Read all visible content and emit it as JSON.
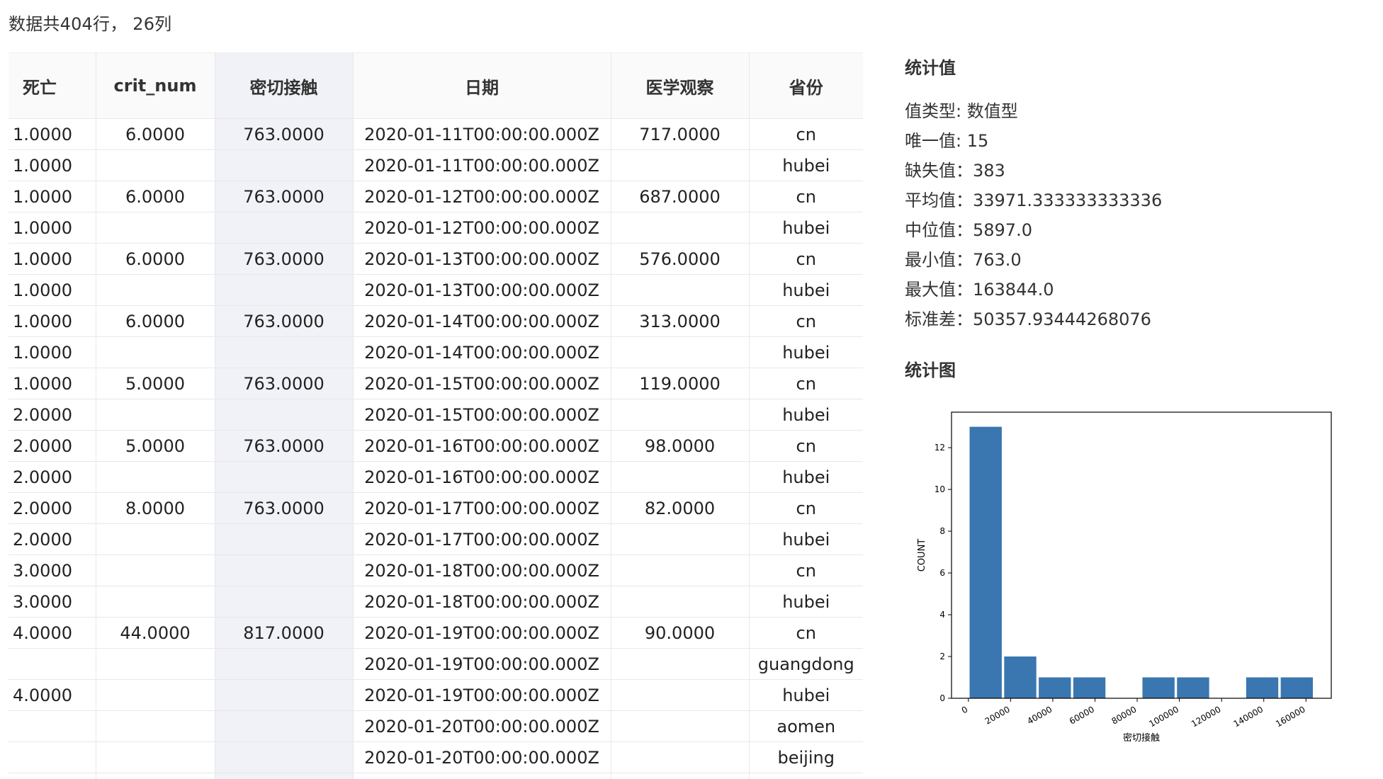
{
  "summary": "数据共404行， 26列",
  "table": {
    "columns": [
      "死亡",
      "crit_num",
      "密切接触",
      "日期",
      "医学观察",
      "省份"
    ],
    "rows": [
      [
        "1.0000",
        "6.0000",
        "763.0000",
        "2020-01-11T00:00:00.000Z",
        "717.0000",
        "cn"
      ],
      [
        "1.0000",
        "",
        "",
        "2020-01-11T00:00:00.000Z",
        "",
        "hubei"
      ],
      [
        "1.0000",
        "6.0000",
        "763.0000",
        "2020-01-12T00:00:00.000Z",
        "687.0000",
        "cn"
      ],
      [
        "1.0000",
        "",
        "",
        "2020-01-12T00:00:00.000Z",
        "",
        "hubei"
      ],
      [
        "1.0000",
        "6.0000",
        "763.0000",
        "2020-01-13T00:00:00.000Z",
        "576.0000",
        "cn"
      ],
      [
        "1.0000",
        "",
        "",
        "2020-01-13T00:00:00.000Z",
        "",
        "hubei"
      ],
      [
        "1.0000",
        "6.0000",
        "763.0000",
        "2020-01-14T00:00:00.000Z",
        "313.0000",
        "cn"
      ],
      [
        "1.0000",
        "",
        "",
        "2020-01-14T00:00:00.000Z",
        "",
        "hubei"
      ],
      [
        "1.0000",
        "5.0000",
        "763.0000",
        "2020-01-15T00:00:00.000Z",
        "119.0000",
        "cn"
      ],
      [
        "2.0000",
        "",
        "",
        "2020-01-15T00:00:00.000Z",
        "",
        "hubei"
      ],
      [
        "2.0000",
        "5.0000",
        "763.0000",
        "2020-01-16T00:00:00.000Z",
        "98.0000",
        "cn"
      ],
      [
        "2.0000",
        "",
        "",
        "2020-01-16T00:00:00.000Z",
        "",
        "hubei"
      ],
      [
        "2.0000",
        "8.0000",
        "763.0000",
        "2020-01-17T00:00:00.000Z",
        "82.0000",
        "cn"
      ],
      [
        "2.0000",
        "",
        "",
        "2020-01-17T00:00:00.000Z",
        "",
        "hubei"
      ],
      [
        "3.0000",
        "",
        "",
        "2020-01-18T00:00:00.000Z",
        "",
        "cn"
      ],
      [
        "3.0000",
        "",
        "",
        "2020-01-18T00:00:00.000Z",
        "",
        "hubei"
      ],
      [
        "4.0000",
        "44.0000",
        "817.0000",
        "2020-01-19T00:00:00.000Z",
        "90.0000",
        "cn"
      ],
      [
        "",
        "",
        "",
        "2020-01-19T00:00:00.000Z",
        "",
        "guangdong"
      ],
      [
        "4.0000",
        "",
        "",
        "2020-01-19T00:00:00.000Z",
        "",
        "hubei"
      ],
      [
        "",
        "",
        "",
        "2020-01-20T00:00:00.000Z",
        "",
        "aomen"
      ],
      [
        "",
        "",
        "",
        "2020-01-20T00:00:00.000Z",
        "",
        "beijing"
      ],
      [
        "",
        "",
        "",
        "",
        "",
        ""
      ]
    ]
  },
  "stats": {
    "title": "统计值",
    "items": [
      "值类型: 数值型",
      "唯一值: 15",
      "缺失值：383",
      "平均值：33971.333333333336",
      "中位值：5897.0",
      "最小值：763.0",
      "最大值：163844.0",
      "标准差：50357.93444268076"
    ]
  },
  "chart_title": "统计图",
  "chart_data": {
    "type": "bar",
    "bin_edges": [
      0,
      16384,
      32768,
      49152,
      65536,
      81920,
      98304,
      114688,
      131072,
      147456,
      163840
    ],
    "values": [
      13,
      2,
      1,
      1,
      0,
      1,
      1,
      0,
      1,
      1
    ],
    "xticks": [
      "0",
      "20000",
      "40000",
      "60000",
      "80000",
      "100000",
      "120000",
      "140000",
      "160000"
    ],
    "xtick_values": [
      0,
      20000,
      40000,
      60000,
      80000,
      100000,
      120000,
      140000,
      160000
    ],
    "xlim": [
      -8000,
      172000
    ],
    "ylim": [
      0,
      13.7
    ],
    "yticks": [
      0,
      2,
      4,
      6,
      8,
      10,
      12
    ],
    "xlabel": "密切接触",
    "ylabel": "COUNT",
    "color": "#3a76af"
  }
}
